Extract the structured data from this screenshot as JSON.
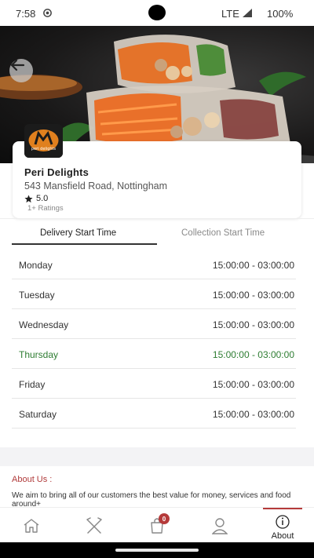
{
  "status_bar": {
    "time": "7:58",
    "network": "LTE",
    "battery": "100%"
  },
  "hero": {
    "image_subject": "spring rolls with vegetables"
  },
  "restaurant": {
    "name": "Peri Delights",
    "address": "543 Mansfield Road, Nottingham",
    "rating": "5.0",
    "ratings_count": "1+ Ratings",
    "logo_text": "peri delights"
  },
  "tabs": [
    {
      "label": "Delivery Start Time",
      "active": true
    },
    {
      "label": "Collection Start Time",
      "active": false
    }
  ],
  "schedule": [
    {
      "day": "Monday",
      "hours": "15:00:00 - 03:00:00"
    },
    {
      "day": "Tuesday",
      "hours": "15:00:00 - 03:00:00"
    },
    {
      "day": "Wednesday",
      "hours": "15:00:00 - 03:00:00"
    },
    {
      "day": "Thursday",
      "hours": "15:00:00 - 03:00:00",
      "today": true
    },
    {
      "day": "Friday",
      "hours": "15:00:00 - 03:00:00"
    },
    {
      "day": "Saturday",
      "hours": "15:00:00 - 03:00:00"
    }
  ],
  "about": {
    "title": "About Us :",
    "text": "We aim to bring all of our customers the best value for money, services and food around+"
  },
  "bottom_nav": {
    "items": [
      {
        "icon": "home-icon"
      },
      {
        "icon": "utensils-icon"
      },
      {
        "icon": "cart-icon",
        "badge": "0"
      },
      {
        "icon": "profile-icon"
      },
      {
        "icon": "info-icon",
        "label": "About",
        "active": true
      }
    ]
  },
  "colors": {
    "accent": "#b53a3a",
    "today": "#2e7d32"
  }
}
